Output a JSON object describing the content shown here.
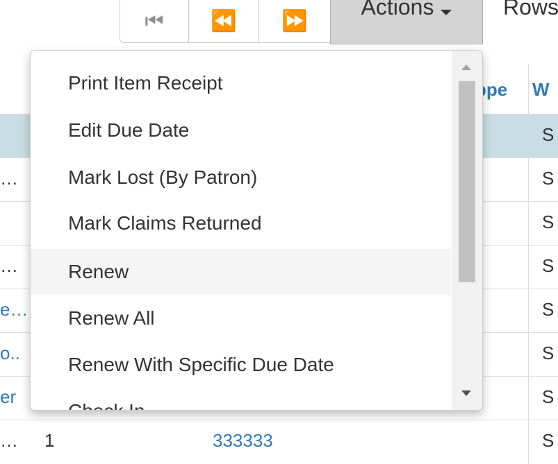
{
  "toolbar": {
    "first_icon": "first-page-icon",
    "prev_icon": "previous-page-icon",
    "next_icon": "next-page-icon",
    "actions_label": "Actions",
    "rows_label": "Rows"
  },
  "grid": {
    "headers": {
      "col_partial": "ppe",
      "col_w": "W"
    },
    "rows": [
      {
        "left": "",
        "right": "S",
        "selected": true
      },
      {
        "left": "…",
        "right": "S"
      },
      {
        "left": "",
        "right": "S"
      },
      {
        "left": "…",
        "right": "S"
      },
      {
        "left": "e…",
        "right": "S"
      },
      {
        "left": "o..",
        "right": "S"
      },
      {
        "left": "er",
        "right": "S"
      },
      {
        "left": "…",
        "count": "1",
        "barcode": "333333",
        "right": "S"
      }
    ]
  },
  "menu": {
    "items": [
      "Print Item Receipt",
      "Edit Due Date",
      "Mark Lost (By Patron)",
      "Mark Claims Returned",
      "Renew",
      "Renew All",
      "Renew With Specific Due Date",
      "Check In"
    ],
    "hover_index": 4
  },
  "colors": {
    "link": "#337ab7",
    "selected_row": "#c9dde4",
    "actions_button_bg": "#d4d4d4"
  }
}
